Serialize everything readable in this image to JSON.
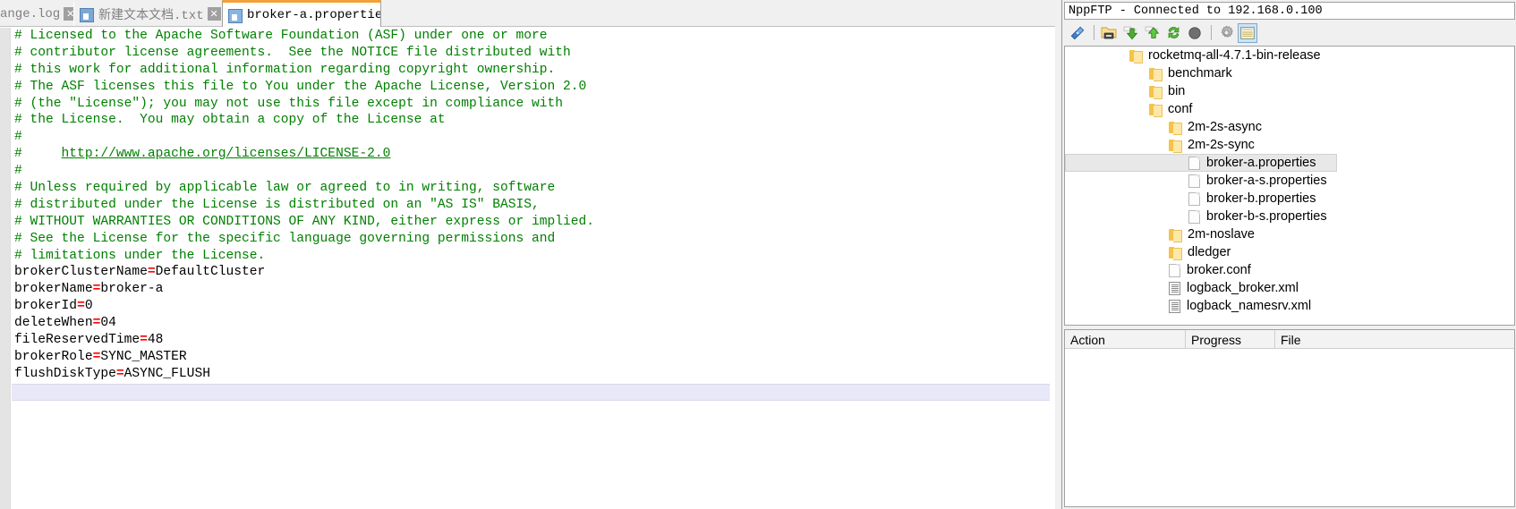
{
  "editor": {
    "tabs": [
      {
        "label": "ange.log",
        "icon": "floppy-save-icon",
        "close_label": "✕",
        "active": false
      },
      {
        "label": "新建文本文档.txt",
        "icon": "floppy-save-icon",
        "close_label": "✕",
        "active": false
      },
      {
        "label": "broker-a.properties",
        "icon": "floppy-save-icon",
        "close_label": "✕",
        "active": true
      }
    ],
    "active_tab_accent": "#f4a038",
    "comment_color": "#008000",
    "operator_color": "#ff0000",
    "current_line_highlight": "#e8e8f8",
    "code_lines": [
      {
        "type": "comment",
        "text": "# Licensed to the Apache Software Foundation (ASF) under one or more"
      },
      {
        "type": "comment",
        "text": "# contributor license agreements.  See the NOTICE file distributed with"
      },
      {
        "type": "comment",
        "text": "# this work for additional information regarding copyright ownership."
      },
      {
        "type": "comment",
        "text": "# The ASF licenses this file to You under the Apache License, Version 2.0"
      },
      {
        "type": "comment",
        "text": "# (the \"License\"); you may not use this file except in compliance with"
      },
      {
        "type": "comment",
        "text": "# the License.  You may obtain a copy of the License at"
      },
      {
        "type": "comment",
        "text": "#"
      },
      {
        "type": "comment-link",
        "prefix": "#     ",
        "link": "http://www.apache.org/licenses/LICENSE-2.0"
      },
      {
        "type": "comment",
        "text": "#"
      },
      {
        "type": "comment",
        "text": "# Unless required by applicable law or agreed to in writing, software"
      },
      {
        "type": "comment",
        "text": "# distributed under the License is distributed on an \"AS IS\" BASIS,"
      },
      {
        "type": "comment",
        "text": "# WITHOUT WARRANTIES OR CONDITIONS OF ANY KIND, either express or implied."
      },
      {
        "type": "comment",
        "text": "# See the License for the specific language governing permissions and"
      },
      {
        "type": "comment",
        "text": "# limitations under the License."
      },
      {
        "type": "property",
        "key": "brokerClusterName",
        "op": "=",
        "value": "DefaultCluster"
      },
      {
        "type": "property",
        "key": "brokerName",
        "op": "=",
        "value": "broker-a"
      },
      {
        "type": "property",
        "key": "brokerId",
        "op": "=",
        "value": "0"
      },
      {
        "type": "property",
        "key": "deleteWhen",
        "op": "=",
        "value": "04"
      },
      {
        "type": "property",
        "key": "fileReservedTime",
        "op": "=",
        "value": "48"
      },
      {
        "type": "property",
        "key": "brokerRole",
        "op": "=",
        "value": "SYNC_MASTER"
      },
      {
        "type": "property",
        "key": "flushDiskType",
        "op": "=",
        "value": "ASYNC_FLUSH"
      }
    ]
  },
  "ftp": {
    "title": "NppFTP - Connected to 192.168.0.100",
    "toolbar": [
      {
        "name": "connect-icon",
        "label": "Connect"
      },
      {
        "name": "open-folder-icon",
        "label": "Open Directory"
      },
      {
        "name": "download-icon",
        "label": "Download"
      },
      {
        "name": "upload-icon",
        "label": "Upload"
      },
      {
        "name": "refresh-icon",
        "label": "Refresh"
      },
      {
        "name": "abort-icon",
        "label": "Abort"
      },
      {
        "name": "settings-gear-icon",
        "label": "Settings"
      },
      {
        "name": "messages-icon",
        "label": "Messages",
        "selected": true
      }
    ],
    "tree": [
      {
        "label": "rocketmq-all-4.7.1-bin-release",
        "icon": "folder-icon",
        "depth": 0,
        "selected": false
      },
      {
        "label": "benchmark",
        "icon": "folder-icon",
        "depth": 1,
        "selected": false
      },
      {
        "label": "bin",
        "icon": "folder-icon",
        "depth": 1,
        "selected": false
      },
      {
        "label": "conf",
        "icon": "folder-icon",
        "depth": 1,
        "selected": false
      },
      {
        "label": "2m-2s-async",
        "icon": "folder-icon",
        "depth": 2,
        "selected": false
      },
      {
        "label": "2m-2s-sync",
        "icon": "folder-icon",
        "depth": 2,
        "selected": false
      },
      {
        "label": "broker-a.properties",
        "icon": "file-icon",
        "depth": 3,
        "selected": true
      },
      {
        "label": "broker-a-s.properties",
        "icon": "file-icon",
        "depth": 3,
        "selected": false
      },
      {
        "label": "broker-b.properties",
        "icon": "file-icon",
        "depth": 3,
        "selected": false
      },
      {
        "label": "broker-b-s.properties",
        "icon": "file-icon",
        "depth": 3,
        "selected": false
      },
      {
        "label": "2m-noslave",
        "icon": "folder-icon",
        "depth": 2,
        "selected": false
      },
      {
        "label": "dledger",
        "icon": "folder-icon",
        "depth": 2,
        "selected": false
      },
      {
        "label": "broker.conf",
        "icon": "file-icon",
        "depth": 2,
        "selected": false
      },
      {
        "label": "logback_broker.xml",
        "icon": "xml-file-icon",
        "depth": 2,
        "selected": false
      },
      {
        "label": "logback_namesrv.xml",
        "icon": "xml-file-icon",
        "depth": 2,
        "selected": false
      }
    ],
    "queue": {
      "columns": [
        "Action",
        "Progress",
        "File"
      ],
      "rows": []
    }
  }
}
